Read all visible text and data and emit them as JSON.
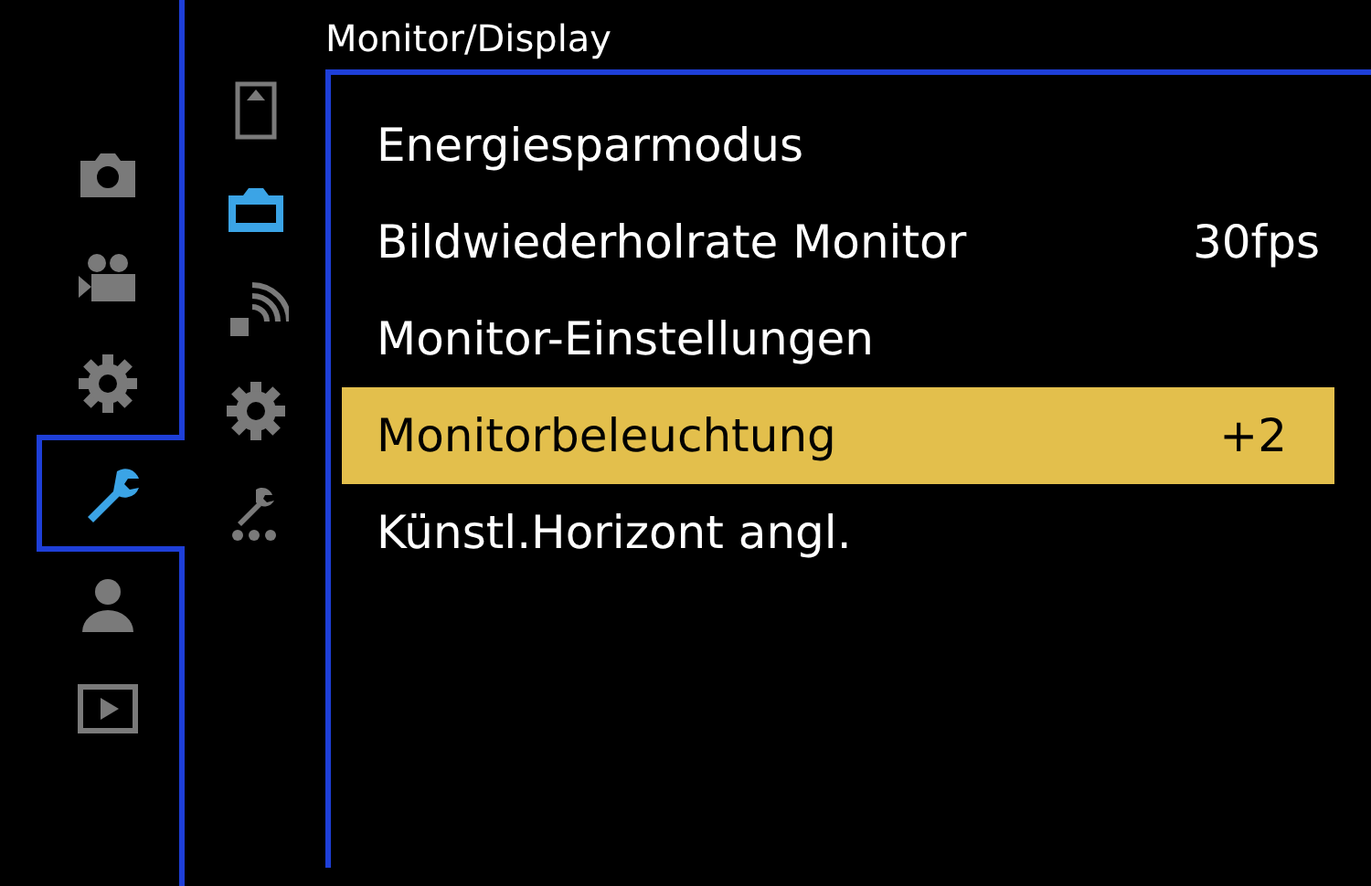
{
  "title": "Monitor/Display",
  "main_tabs": [
    {
      "kind": "camera",
      "selected": false
    },
    {
      "kind": "movie",
      "selected": false
    },
    {
      "kind": "gear",
      "selected": false
    },
    {
      "kind": "wrench",
      "selected": true
    },
    {
      "kind": "person",
      "selected": false
    },
    {
      "kind": "play",
      "selected": false
    }
  ],
  "sub_tabs": [
    {
      "kind": "card",
      "selected": false
    },
    {
      "kind": "monitor",
      "selected": true
    },
    {
      "kind": "wireless",
      "selected": false
    },
    {
      "kind": "gear",
      "selected": false
    },
    {
      "kind": "tools",
      "selected": false
    }
  ],
  "items": [
    {
      "label": "Energiesparmodus",
      "selected": false
    },
    {
      "label": "Bildwiederholrate Monitor",
      "value": "30fps",
      "selected": false
    },
    {
      "label": "Monitor-Einstellungen",
      "selected": false
    },
    {
      "label": "Monitorbeleuchtung",
      "value": "+2",
      "selected": true
    },
    {
      "label": "Künstl.Horizont angl.",
      "selected": false
    }
  ]
}
